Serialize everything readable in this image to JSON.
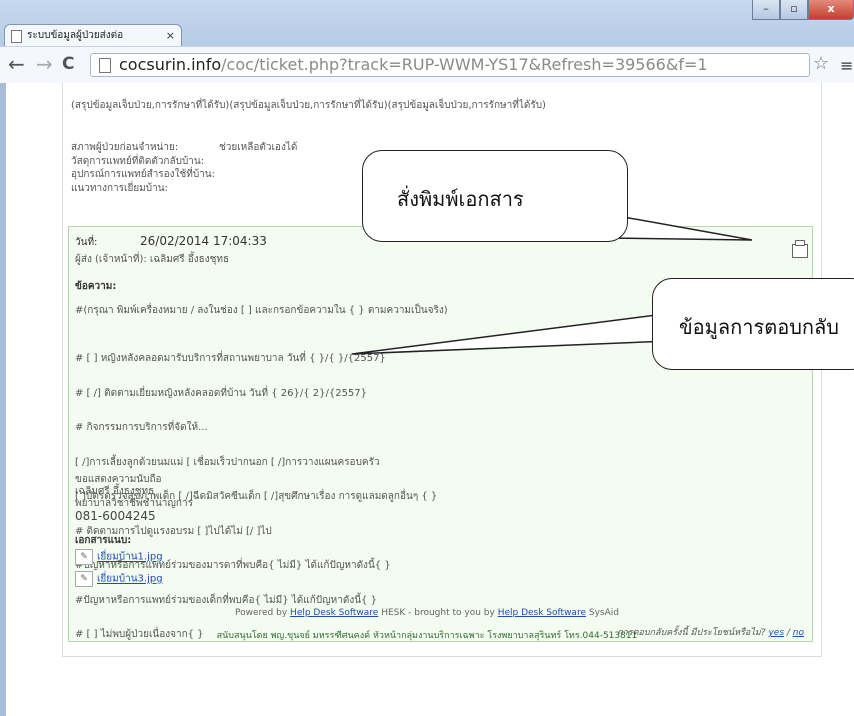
{
  "browser": {
    "tab_title": "ระบบข้อมูลผู้ป่วยส่งต่อ",
    "tab_close": "×",
    "window_controls": {
      "minimize": "–",
      "maximize": "▫",
      "close": "x"
    },
    "nav": {
      "back": "←",
      "forward": "→",
      "reload": "C"
    },
    "url_domain": "cocsurin.info",
    "url_path": "/coc/ticket.php?track=RUP-WWM-YS17&Refresh=39566&f=1",
    "bookmark_star": "☆",
    "menu": "≡"
  },
  "page": {
    "summary_line": "(สรุปข้อมูลเจ็บป่วย,การรักษาที่ได้รับ)(สรุปข้อมูลเจ็บป่วย,การรักษาที่ได้รับ)(สรุปข้อมูลเจ็บป่วย,การรักษาที่ได้รับ)",
    "fields": [
      {
        "label": "สภาพผู้ป่วยก่อนจำหน่าย:",
        "value": "ช่วยเหลือตัวเองได้"
      },
      {
        "label": "วัสดุการแพทย์ที่ติดตัวกลับบ้าน:",
        "value": ""
      },
      {
        "label": "อุปกรณ์การแพทย์สำรองใช้ที่บ้าน:",
        "value": ""
      },
      {
        "label": "แนวทางการเยี่ยมบ้าน:",
        "value": ""
      }
    ],
    "reply": {
      "date_label": "วันที่:",
      "date_value": "26/02/2014 17:04:33",
      "sender": "ผู้ส่ง (เจ้าหน้าที่): เฉลิมศรี อึ้งธงชุทธ",
      "message_title": "ข้อความ:",
      "instruction": "#(กรุณา พิมพ์เครื่องหมาย / ลงในช่อง [ ] และกรอกข้อความใน { } ตามความเป็นจริง)",
      "checklist": [
        "# [ ] หญิงหลังคลอดมารับบริการที่สถานพยาบาล วันที่ { }/{ }/{2557}",
        "# [ /] ติดตามเยี่ยมหญิงหลังคลอดที่บ้าน วันที่ { 26}/{ 2}/{2557}",
        "# กิจกรรมการบริการที่จัดให้...",
        "[ /]การเลี้ยงลูกด้วยนมแม่ [ เชื่อมเร็วปากนอก [ /]การวางแผนครอบครัว",
        "[ ]บัตรตรวจสุขภาพเด็ก [ /]ฉีดมิสวัคซีนเด็ก [ /]สุขศึกษาเรื่อง การดูแลมดลูกอื่นๆ { }",
        "# ติดตามการไปดูแรงอบรม [ ]ไปได้ไม่ [/ ]ไป",
        "#ปัญหาหรือการแพทย์ร่วมของมารดาที่พบคือ{ ไม่มี} ได้แก้ปัญหาดังนี้{ }",
        "#ปัญหาหรือการแพทย์ร่วมของเด็กที่พบคือ{ ไม่มี} ได้แก้ปัญหาดังนี้{ }",
        "# [ ] ไม่พบผู้ป่วยเนื่องจาก{ }"
      ],
      "signoff": [
        "ขอแสดงความนับถือ",
        "เฉลิมศรี อึ้งธงชุทธ",
        "พยาบาลวิชาชีพชำนาญการ"
      ],
      "phone": "081-6004245",
      "attachments_title": "เอกสารแนบ:",
      "attachments": [
        "เยี่ยมบ้าน1.jpg",
        "เยี่ยมบ้าน3.jpg"
      ],
      "helpful_question": "การตอบกลับครั้งนี้ มีประโยชน์หรือไม่?",
      "helpful_yes": "yes",
      "helpful_separator": " / ",
      "helpful_no": "no"
    },
    "footer": {
      "powered_prefix": "Powered by",
      "powered_link": "Help Desk Software",
      "powered_mid": "HESK - brought to you by",
      "powered_link2": "Help Desk Software",
      "powered_suffix": "SysAid",
      "sponsor": "สนับสนุนโดย พญ.ขุนจย์ มหรรฑีศนคงค์ หัวหน้ากลุ่มงานบริการเฉพาะ โรงพยาบาลสุรินทร์ โทร.044-513811"
    }
  },
  "callouts": {
    "print_document": "สั่งพิมพ์เอกสาร",
    "reply_info": "ข้อมูลการตอบกลับ"
  }
}
